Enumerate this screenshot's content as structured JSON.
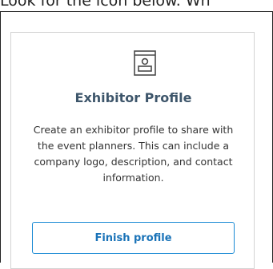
{
  "instruction": {
    "text": "Look for the icon below. Wh"
  },
  "card": {
    "icon": "exhibitor-booth-icon",
    "title": "Exhibitor Profile",
    "description": "Create an exhibitor profile to share with the event planners. This can include a company logo, description, and contact information.",
    "button_label": "Finish profile",
    "colors": {
      "title": "#3e566b",
      "button_border": "#1a8ad4",
      "button_text": "#1a73b8",
      "card_border": "#d3d3d3"
    }
  }
}
